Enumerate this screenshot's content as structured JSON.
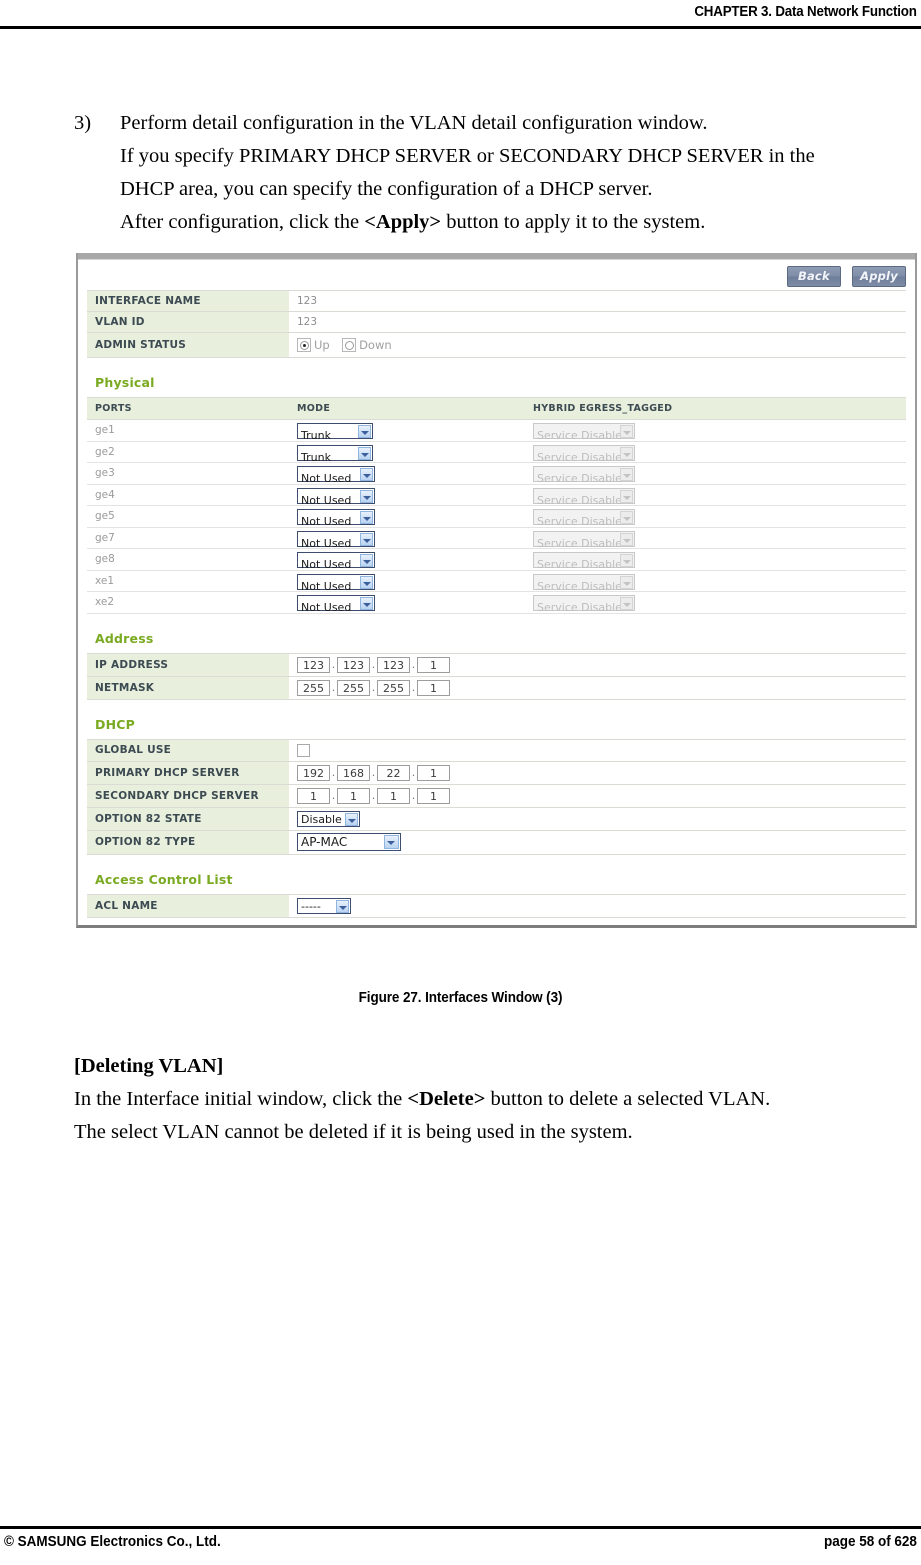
{
  "header": {
    "chapter": "CHAPTER 3. Data Network Function"
  },
  "body": {
    "step_number": "3)",
    "step_lines": [
      "Perform detail configuration in the VLAN detail configuration window.",
      "If you specify PRIMARY DHCP SERVER or SECONDARY DHCP SERVER in the",
      "DHCP area, you can specify the configuration of a DHCP server."
    ],
    "step_last_pre": "After configuration, click the ",
    "step_last_bold": "<Apply>",
    "step_last_post": " button to apply it to the system."
  },
  "figure": {
    "caption": "Figure 27. Interfaces Window (3)"
  },
  "deleting": {
    "heading": "[Deleting VLAN]",
    "line1_pre": "In the Interface initial window, click the ",
    "line1_bold": "<Delete>",
    "line1_post": " button to delete a selected VLAN.",
    "line2": "The select VLAN cannot be deleted if it is being used in the system."
  },
  "footer": {
    "copyright": "© SAMSUNG Electronics Co., Ltd.",
    "page": "page 58 of 628"
  },
  "screenshot": {
    "buttons": {
      "back": "Back",
      "apply": "Apply"
    },
    "general": {
      "rows": [
        {
          "label": "INTERFACE NAME",
          "value": "123"
        },
        {
          "label": "VLAN ID",
          "value": "123"
        }
      ],
      "admin_status": {
        "label": "ADMIN STATUS",
        "up_label": "Up",
        "down_label": "Down",
        "selected": "Up"
      }
    },
    "physical": {
      "title": "Physical",
      "columns": [
        "PORTS",
        "MODE",
        "HYBRID EGRESS_TAGGED"
      ],
      "rows": [
        {
          "port": "ge1",
          "mode": "Trunk",
          "hybrid": "Service Disable"
        },
        {
          "port": "ge2",
          "mode": "Trunk",
          "hybrid": "Service Disable"
        },
        {
          "port": "ge3",
          "mode": "Not Used",
          "hybrid": "Service Disable"
        },
        {
          "port": "ge4",
          "mode": "Not Used",
          "hybrid": "Service Disable"
        },
        {
          "port": "ge5",
          "mode": "Not Used",
          "hybrid": "Service Disable"
        },
        {
          "port": "ge7",
          "mode": "Not Used",
          "hybrid": "Service Disable"
        },
        {
          "port": "ge8",
          "mode": "Not Used",
          "hybrid": "Service Disable"
        },
        {
          "port": "xe1",
          "mode": "Not Used",
          "hybrid": "Service Disable"
        },
        {
          "port": "xe2",
          "mode": "Not Used",
          "hybrid": "Service Disable"
        }
      ]
    },
    "address": {
      "title": "Address",
      "ip_address": {
        "label": "IP ADDRESS",
        "octets": [
          "123",
          "123",
          "123",
          "1"
        ]
      },
      "netmask": {
        "label": "NETMASK",
        "octets": [
          "255",
          "255",
          "255",
          "1"
        ]
      }
    },
    "dhcp": {
      "title": "DHCP",
      "global_use": {
        "label": "GLOBAL USE",
        "checked": false
      },
      "primary": {
        "label": "PRIMARY DHCP SERVER",
        "octets": [
          "192",
          "168",
          "22",
          "1"
        ]
      },
      "secondary": {
        "label": "SECONDARY DHCP SERVER",
        "octets": [
          "1",
          "1",
          "1",
          "1"
        ]
      },
      "option82_state": {
        "label": "OPTION 82 STATE",
        "value": "Disable"
      },
      "option82_type": {
        "label": "OPTION 82 TYPE",
        "value": "AP-MAC"
      }
    },
    "acl": {
      "title": "Access Control List",
      "acl_name": {
        "label": "ACL NAME",
        "value": "-----"
      }
    },
    "colors": {
      "section_title": "#7aaa21",
      "label_cell_bg": "#e9efdd",
      "button_bg": "#7f8da8"
    }
  }
}
